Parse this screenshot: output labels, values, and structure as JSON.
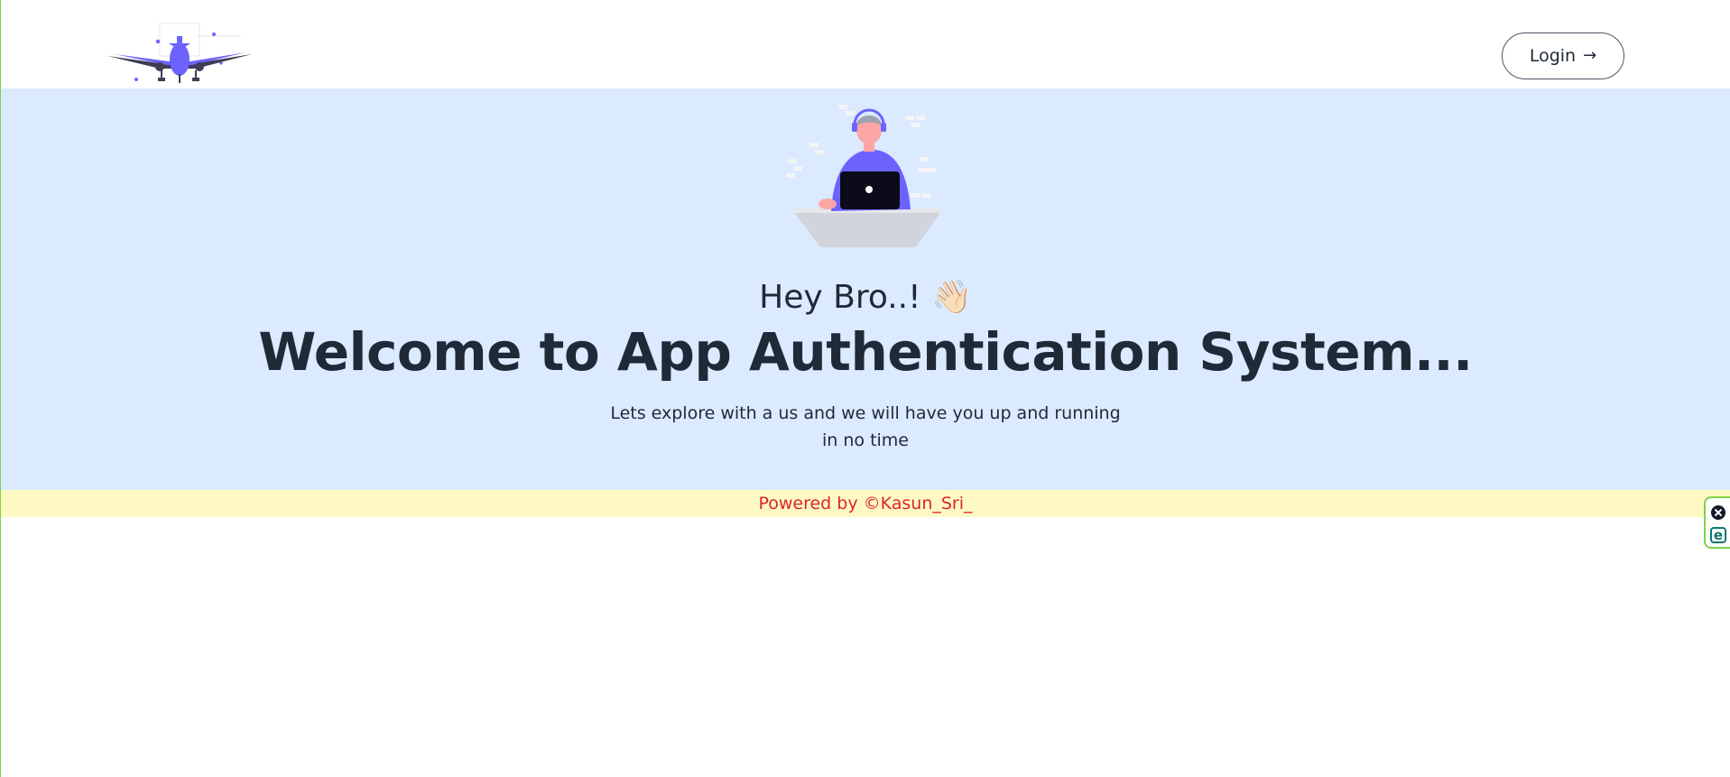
{
  "header": {
    "logo_icon": "airplane-logo-icon",
    "login_label": "Login",
    "login_icon": "arrow-right-icon"
  },
  "hero": {
    "illustration": "person-with-laptop-illustration",
    "greeting": "Hey Bro..! 👋🏻",
    "title": "Welcome to App Authentication System...",
    "subtitle": "Lets explore with a us and we will have you up and running in no time"
  },
  "footer": {
    "text": "Powered by ©Kasun_Sri_"
  },
  "extension": {
    "close_icon": "close-circle-icon",
    "e_icon": "extension-e-icon"
  },
  "colors": {
    "hero_bg": "#dbeafe",
    "footer_bg": "#fef9c3",
    "footer_text": "#dc2626",
    "accent": "#6c63ff",
    "text": "#1f2937"
  }
}
